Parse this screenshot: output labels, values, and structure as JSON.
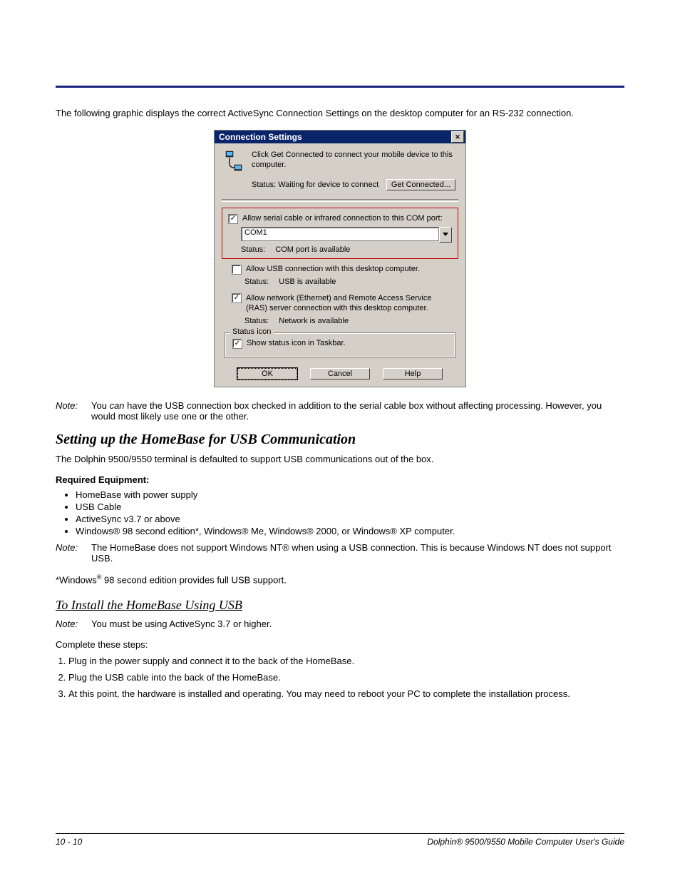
{
  "intro": "The following graphic displays the correct ActiveSync Connection Settings on the desktop computer for an RS-232 connection.",
  "dialog": {
    "title": "Connection Settings",
    "close": "✕",
    "instruction": "Click Get Connected to connect your mobile device to this computer.",
    "status_label": "Status: Waiting for device to connect",
    "get_connected": "Get Connected...",
    "serial": {
      "checked": "✓",
      "label": "Allow serial cable or infrared connection to this COM port:",
      "port": "COM1",
      "status_k": "Status:",
      "status_v": "COM port is available"
    },
    "usb": {
      "checked": "",
      "label": "Allow USB connection with this desktop computer.",
      "status_k": "Status:",
      "status_v": "USB is available"
    },
    "net": {
      "checked": "✓",
      "label": "Allow network (Ethernet) and Remote Access Service (RAS) server connection with this desktop computer.",
      "status_k": "Status:",
      "status_v": "Network is available"
    },
    "group": {
      "title": "Status icon",
      "checked": "✓",
      "label": "Show status icon in Taskbar."
    },
    "buttons": {
      "ok": "OK",
      "cancel": "Cancel",
      "help": "Help"
    }
  },
  "note1": {
    "label": "Note:",
    "pre": "You ",
    "can": "can",
    "post": " have the USB connection box checked in addition to the serial cable box without affecting processing. However, you would most likely use one or the other."
  },
  "heading1": "Setting up the HomeBase for USB Communication",
  "p1": "The Dolphin 9500/9550 terminal is defaulted to support USB communications out of the box.",
  "req_h": "Required Equipment:",
  "req": [
    "HomeBase with power supply",
    "USB Cable",
    "ActiveSync v3.7 or above",
    "Windows® 98 second edition*, Windows® Me, Windows® 2000, or Windows® XP computer."
  ],
  "note2": {
    "label": "Note:",
    "text": "The HomeBase does not support Windows NT® when using a USB connection. This is because Windows NT does not support USB."
  },
  "asterisk_pre": "*Windows",
  "asterisk_sup": "®",
  "asterisk_post": " 98 second edition provides full USB support.",
  "heading2": "To Install the HomeBase Using USB",
  "note3": {
    "label": "Note:",
    "text": "You must be using ActiveSync 3.7 or higher."
  },
  "complete": "Complete these steps:",
  "steps": [
    "Plug in the power supply and connect it to the back of the HomeBase.",
    "Plug the USB cable into the back of the HomeBase.",
    "At this point, the hardware is installed and operating. You may need to reboot your PC to complete the installation process."
  ],
  "footer": {
    "left": "10 - 10",
    "right": "Dolphin® 9500/9550 Mobile Computer User's Guide"
  }
}
